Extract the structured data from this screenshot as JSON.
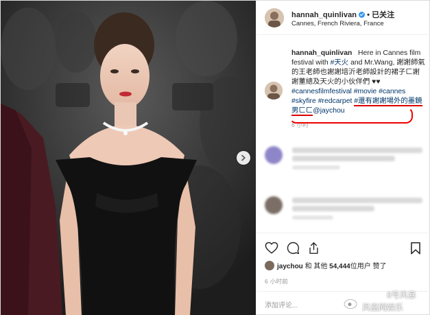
{
  "post": {
    "username": "hannah_quinlivan",
    "follow_status": "已关注",
    "separator": "•",
    "location": "Cannes, French Riviera, France"
  },
  "caption": {
    "username": "hannah_quinlivan",
    "line1": "Here in Cannes film festival with",
    "tag_skyfire_cn": "#天火",
    "line2": "and Mr.Wang, 謝謝師氣的王老師也謝謝培沂老師設計的裙子ㄈ謝謝董總及天火的小伙伴們 ♥♥",
    "tag_cannesfilmfestival": "#cannesfilmfestival",
    "tag_movie": "#movie",
    "tag_cannes": "#cannes",
    "tag_skyfire": "#skyfire",
    "tag_redcarpet": "#redcarpet",
    "tag_highlight": "#還有謝謝場外的墨鏡男ㄈㄈ",
    "mention": "@jaychou",
    "time": "6 小时"
  },
  "likes": {
    "user": "jaychou",
    "connector": "和 其他",
    "count": "54,444",
    "suffix": "位用户 赞了"
  },
  "post_time": "6 小时前",
  "add_comment": {
    "placeholder": "添加评论..."
  },
  "watermark": {
    "line1": "8号风暴",
    "line2": "凤凰网娱乐"
  },
  "icons": {
    "verified": "verified-badge-icon",
    "like": "heart-icon",
    "comment": "comment-icon",
    "share": "share-icon",
    "save": "bookmark-icon",
    "next": "chevron-right-icon"
  },
  "colors": {
    "link": "#003569",
    "verified": "#3897f0",
    "highlight": "#e00000",
    "muted": "#999999"
  }
}
